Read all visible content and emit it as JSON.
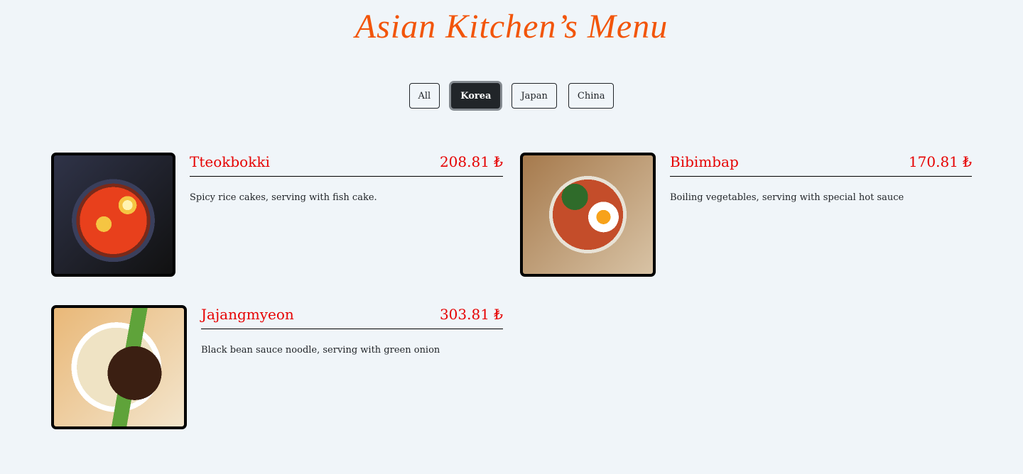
{
  "header": {
    "title": "Asian Kitchen’s Menu"
  },
  "filters": {
    "items": [
      "All",
      "Korea",
      "Japan",
      "China"
    ],
    "active": "Korea"
  },
  "menu": {
    "items": [
      {
        "name": "Tteokbokki",
        "price": "208.81 ₺",
        "desc": "Spicy rice cakes, serving with fish cake.",
        "image": "tteokbokki-photo"
      },
      {
        "name": "Bibimbap",
        "price": "170.81 ₺",
        "desc": "Boiling vegetables, serving with special hot sauce",
        "image": "bibimbap-photo"
      },
      {
        "name": "Jajangmyeon",
        "price": "303.81 ₺",
        "desc": "Black bean sauce noodle, serving with green onion",
        "image": "jajangmyeon-photo"
      }
    ]
  },
  "colors": {
    "title": "#f2550a",
    "item_name": "#e60000",
    "active_button": "#212529",
    "background": "#f0f5f9"
  }
}
